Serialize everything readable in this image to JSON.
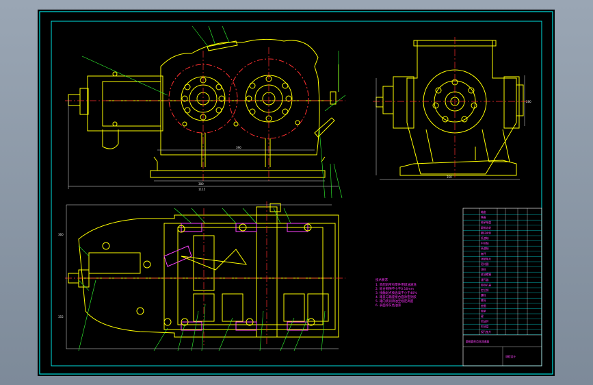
{
  "colors": {
    "background": "#8e9aa8",
    "sheet": "#000000",
    "frame": "#00e0e0",
    "outline": "#ffff00",
    "center_line": "#ff3030",
    "hidden_line": "#e8e8e8",
    "leader": "#33ff33",
    "text": "#ff33ff",
    "hatch": "#ff44ff"
  },
  "icons": {
    "front_view": "gearbox-front-elevation",
    "side_view": "gearbox-side-elevation",
    "top_view": "gearbox-plan-section"
  },
  "dims": {
    "front_width": "1115",
    "front_span": "380",
    "base_len": "390",
    "side_height": "280",
    "side_base": "350",
    "top_height": "360",
    "top_left": "355"
  },
  "notes": {
    "tech_title": "技术要求",
    "tech_lines": [
      "1. 装配前所有零件用煤油清洗",
      "2. 啮合侧隙不小于0.16mm",
      "3. 接触斑点按齿高不小于40%",
      "4. 箱盖与箱座接合面涂密封胶",
      "5. 箱内装润滑油至规定高度",
      "6. 表面涂灰色油漆"
    ]
  },
  "title_block": {
    "rows": [
      "箱座",
      "箱盖",
      "轴承端盖",
      "圆锥齿轮",
      "圆柱齿轮",
      "低速轴",
      "中间轴",
      "高速轴",
      "套杯",
      "调整垫片",
      "密封圈",
      "油标",
      "放油螺塞",
      "通气器",
      "窥视孔盖",
      "定位销",
      "螺栓",
      "螺母",
      "垫圈",
      "轴承",
      "键",
      "挡油环",
      "甩油盘",
      "视孔垫片"
    ],
    "title": "圆锥圆柱齿轮减速器",
    "school": "课程设计"
  }
}
